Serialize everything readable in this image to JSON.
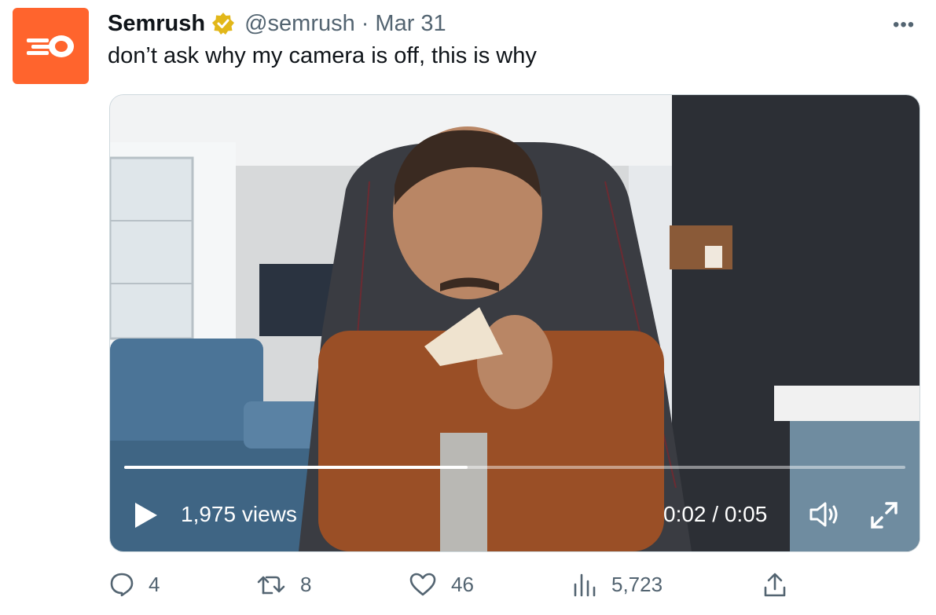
{
  "tweet": {
    "author_name": "Semrush",
    "handle": "@semrush",
    "separator": "·",
    "date": "Mar 31",
    "more_label": "•••",
    "text": "don’t ask why my camera is off, this is why"
  },
  "video": {
    "views": "1,975 views",
    "time": "0:02 / 0:05",
    "progress": 0.44
  },
  "actions": {
    "replies": "4",
    "reposts": "8",
    "likes": "46",
    "views": "5,723"
  },
  "colors": {
    "brand": "#ff642d",
    "muted": "#536471",
    "verified": "#e2b719"
  }
}
